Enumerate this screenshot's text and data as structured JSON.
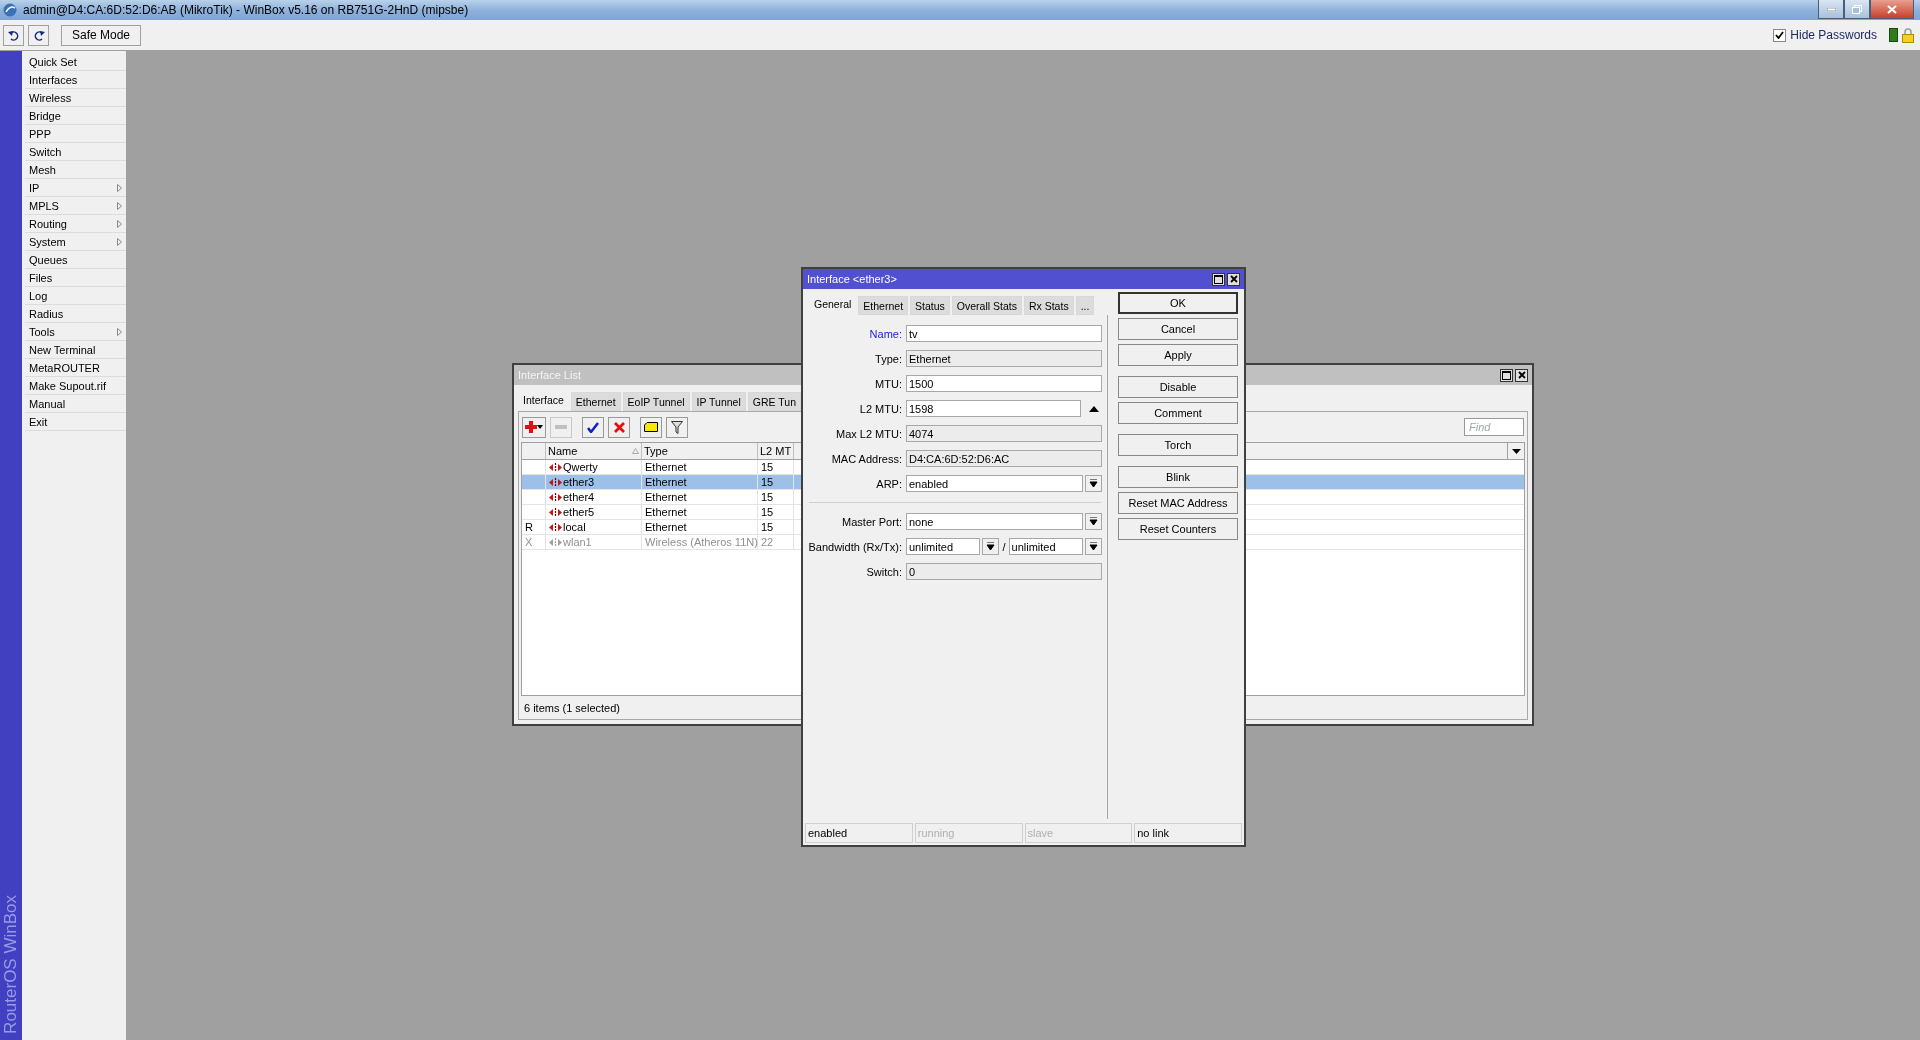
{
  "window": {
    "title": "admin@D4:CA:6D:52:D6:AB (MikroTik) - WinBox v5.16 on RB751G-2HnD (mipsbe)"
  },
  "toolbar": {
    "safe_mode_button": "Safe Mode",
    "hide_passwords": {
      "label": "Hide Passwords",
      "checked": true
    }
  },
  "sidebar": {
    "brand": "RouterOS WinBox",
    "items": [
      {
        "label": "Quick Set",
        "has_submenu": false
      },
      {
        "label": "Interfaces",
        "has_submenu": false
      },
      {
        "label": "Wireless",
        "has_submenu": false
      },
      {
        "label": "Bridge",
        "has_submenu": false
      },
      {
        "label": "PPP",
        "has_submenu": false
      },
      {
        "label": "Switch",
        "has_submenu": false
      },
      {
        "label": "Mesh",
        "has_submenu": false
      },
      {
        "label": "IP",
        "has_submenu": true
      },
      {
        "label": "MPLS",
        "has_submenu": true
      },
      {
        "label": "Routing",
        "has_submenu": true
      },
      {
        "label": "System",
        "has_submenu": true
      },
      {
        "label": "Queues",
        "has_submenu": false
      },
      {
        "label": "Files",
        "has_submenu": false
      },
      {
        "label": "Log",
        "has_submenu": false
      },
      {
        "label": "Radius",
        "has_submenu": false
      },
      {
        "label": "Tools",
        "has_submenu": true
      },
      {
        "label": "New Terminal",
        "has_submenu": false
      },
      {
        "label": "MetaROUTER",
        "has_submenu": false
      },
      {
        "label": "Make Supout.rif",
        "has_submenu": false
      },
      {
        "label": "Manual",
        "has_submenu": false
      },
      {
        "label": "Exit",
        "has_submenu": false
      }
    ]
  },
  "interface_list": {
    "title": "Interface List",
    "tabs": [
      {
        "label": "Interface",
        "selected": true
      },
      {
        "label": "Ethernet",
        "selected": false
      },
      {
        "label": "EoIP Tunnel",
        "selected": false
      },
      {
        "label": "IP Tunnel",
        "selected": false
      },
      {
        "label": "GRE Tun",
        "selected": false
      }
    ],
    "toolbar_buttons": [
      {
        "kind": "add",
        "disabled": false
      },
      {
        "kind": "remove",
        "disabled": true
      },
      {
        "kind": "enable",
        "disabled": false
      },
      {
        "kind": "disable",
        "disabled": false
      },
      {
        "kind": "comment",
        "disabled": false
      },
      {
        "kind": "filter",
        "disabled": false
      }
    ],
    "find_placeholder": "Find",
    "columns": [
      {
        "label": "Name",
        "sorted": true
      },
      {
        "label": "Type"
      },
      {
        "label": "L2 MT"
      }
    ],
    "rows": [
      {
        "name": "Qwerty",
        "type": "Ethernet",
        "l2mtu": "15",
        "selected": false,
        "disabled": false
      },
      {
        "name": "ether3",
        "type": "Ethernet",
        "l2mtu": "15",
        "selected": true,
        "disabled": false
      },
      {
        "name": "ether4",
        "type": "Ethernet",
        "l2mtu": "15",
        "selected": false,
        "disabled": false
      },
      {
        "name": "ether5",
        "type": "Ethernet",
        "l2mtu": "15",
        "selected": false,
        "disabled": false
      },
      {
        "flag": "R",
        "name": "local",
        "type": "Ethernet",
        "l2mtu": "15",
        "selected": false,
        "disabled": false
      },
      {
        "flag": "X",
        "name": "wlan1",
        "type": "Wireless (Atheros 11N)",
        "l2mtu": "22",
        "selected": false,
        "disabled": true
      }
    ],
    "status": "6 items (1 selected)"
  },
  "dialog": {
    "title": "Interface <ether3>",
    "tabs": [
      {
        "label": "General",
        "selected": true
      },
      {
        "label": "Ethernet",
        "selected": false
      },
      {
        "label": "Status",
        "selected": false
      },
      {
        "label": "Overall Stats",
        "selected": false
      },
      {
        "label": "Rx Stats",
        "selected": false
      },
      {
        "label": "...",
        "selected": false
      }
    ],
    "fields": [
      {
        "kind": "text",
        "label": "Name:",
        "value": "tv",
        "highlighted": true
      },
      {
        "kind": "readonly",
        "label": "Type:",
        "value": "Ethernet",
        "highlighted": false
      },
      {
        "kind": "text",
        "label": "MTU:",
        "value": "1500",
        "highlighted": false
      },
      {
        "kind": "spin",
        "label": "L2 MTU:",
        "value": "1598",
        "highlighted": false
      },
      {
        "kind": "readonly",
        "label": "Max L2 MTU:",
        "value": "4074",
        "highlighted": false
      },
      {
        "kind": "readonly",
        "label": "MAC Address:",
        "value": "D4:CA:6D:52:D6:AC",
        "highlighted": false
      },
      {
        "kind": "dropdown",
        "label": "ARP:",
        "value": "enabled",
        "highlighted": false
      },
      {
        "kind": "separator"
      },
      {
        "kind": "dropdown",
        "label": "Master Port:",
        "value": "none",
        "highlighted": false
      },
      {
        "kind": "pair",
        "label": "Bandwidth (Rx/Tx):",
        "values": [
          "unlimited",
          "unlimited"
        ],
        "joiner": "/",
        "highlighted": false
      },
      {
        "kind": "readonly",
        "label": "Switch:",
        "value": "0",
        "highlighted": false
      }
    ],
    "button_groups": [
      [
        {
          "label": "OK",
          "default": true
        },
        {
          "label": "Cancel",
          "default": false
        },
        {
          "label": "Apply",
          "default": false
        }
      ],
      [
        {
          "label": "Disable",
          "default": false
        },
        {
          "label": "Comment",
          "default": false
        }
      ],
      [
        {
          "label": "Torch",
          "default": false
        }
      ],
      [
        {
          "label": "Blink",
          "default": false
        },
        {
          "label": "Reset MAC Address",
          "default": false
        },
        {
          "label": "Reset Counters",
          "default": false
        }
      ]
    ],
    "status": [
      {
        "text": "enabled",
        "active": true
      },
      {
        "text": "running",
        "active": false
      },
      {
        "text": "slave",
        "active": false
      },
      {
        "text": "no link",
        "active": true
      }
    ]
  }
}
